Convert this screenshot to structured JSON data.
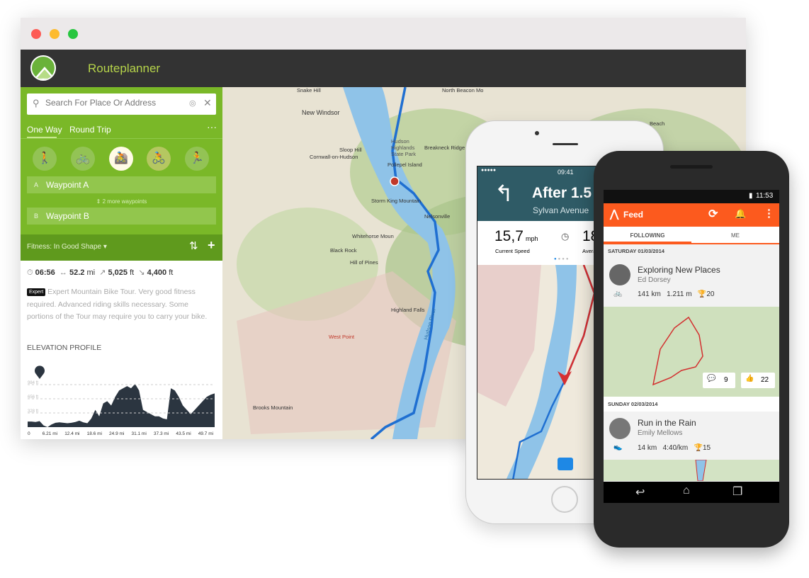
{
  "window": {
    "title": "Routeplanner"
  },
  "search": {
    "placeholder": "Search For Place Or Address"
  },
  "tabs": [
    {
      "label": "One Way",
      "active": true
    },
    {
      "label": "Round Trip",
      "active": false
    }
  ],
  "modes": [
    {
      "icon": "hiking-icon",
      "selected": false
    },
    {
      "icon": "bike-touring-icon",
      "selected": false
    },
    {
      "icon": "mountain-bike-icon",
      "selected": true
    },
    {
      "icon": "road-bike-icon",
      "selected": false
    },
    {
      "icon": "running-icon",
      "selected": false
    }
  ],
  "waypoints": [
    {
      "letter": "A",
      "label": "Waypoint A"
    },
    {
      "letter": "B",
      "label": "Waypoint B"
    }
  ],
  "more_waypoints": "2 more waypoints",
  "fitness": "Fitness: In Good Shape",
  "stats": {
    "duration": "06:56",
    "distance": "52.2",
    "distance_unit": "mi",
    "uphill": "5,025",
    "downhill": "4,400",
    "unit": "ft"
  },
  "difficulty_badge": "Expert",
  "description": "Expert Mountain Bike Tour. Very good fitness required. Advanced riding skills necessary. Some portions of the Tour may require you to carry your bike.",
  "elevation": {
    "title": "ELEVATION PROFILE",
    "y_ticks": [
      "984 ft",
      "656 ft",
      "328 ft"
    ],
    "x_ticks": [
      "0",
      "6.21 mi",
      "12.4 mi",
      "18.6 mi",
      "24.9 mi",
      "31.1 mi",
      "37.3 mi",
      "43.5 mi",
      "49.7 mi"
    ],
    "values_ft": [
      130,
      130,
      120,
      140,
      40,
      0,
      60,
      100,
      110,
      100,
      90,
      100,
      120,
      150,
      110,
      90,
      200,
      400,
      250,
      550,
      600,
      500,
      700,
      850,
      900,
      950,
      900,
      1000,
      850,
      400,
      350,
      300,
      250,
      250,
      200,
      180,
      900,
      850,
      700,
      500,
      400,
      300,
      400,
      500,
      600,
      700,
      750,
      780
    ],
    "x_max_mi": 52.2,
    "colors": {
      "fill": "#2b3540"
    }
  },
  "map_labels": [
    "Snake Hill",
    "North Beacon Mo",
    "New Windsor",
    "Sloop Hill",
    "Hudson Highlands State Park",
    "Breakneck Ridge",
    "Pollepel Island",
    "Cornwall-on-Hudson",
    "Storm King Mountain",
    "Nelsonville",
    "Whitehorse Moun",
    "Black Rock",
    "Hill of Pines",
    "West Point",
    "Highland Falls",
    "Brooks Mountain",
    "Beach",
    "Hudson River"
  ],
  "iphone": {
    "signal": "●●●●●",
    "time": "09:41",
    "instruction": "After 1.5",
    "street": "Sylvan Avenue",
    "speed": "15,7",
    "speed_unit": "mph",
    "speed_label": "Current Speed",
    "avg_partial": "18",
    "avg_label_partial": "Avera"
  },
  "android": {
    "time": "11:53",
    "title": "Feed",
    "tabs": [
      "FOLLOWING",
      "ME"
    ],
    "feed": [
      {
        "date": "SATURDAY 01/03/2014",
        "title": "Exploring New Places",
        "athlete": "Ed Dorsey",
        "distance": "141 km",
        "metric": "1.211 m",
        "trophies": "20",
        "comments": "9",
        "kudos": "22"
      },
      {
        "date": "SUNDAY 02/03/2014",
        "title": "Run in the Rain",
        "athlete": "Emily Mellows",
        "distance": "14 km",
        "metric": "4:40/km",
        "trophies": "15"
      }
    ]
  },
  "colors": {
    "komoot_green": "#7ab828",
    "strava_orange": "#fc5a1e",
    "nav_teal": "#2f5b66",
    "river": "#8fc3e8",
    "route": "#1f6fd1"
  }
}
